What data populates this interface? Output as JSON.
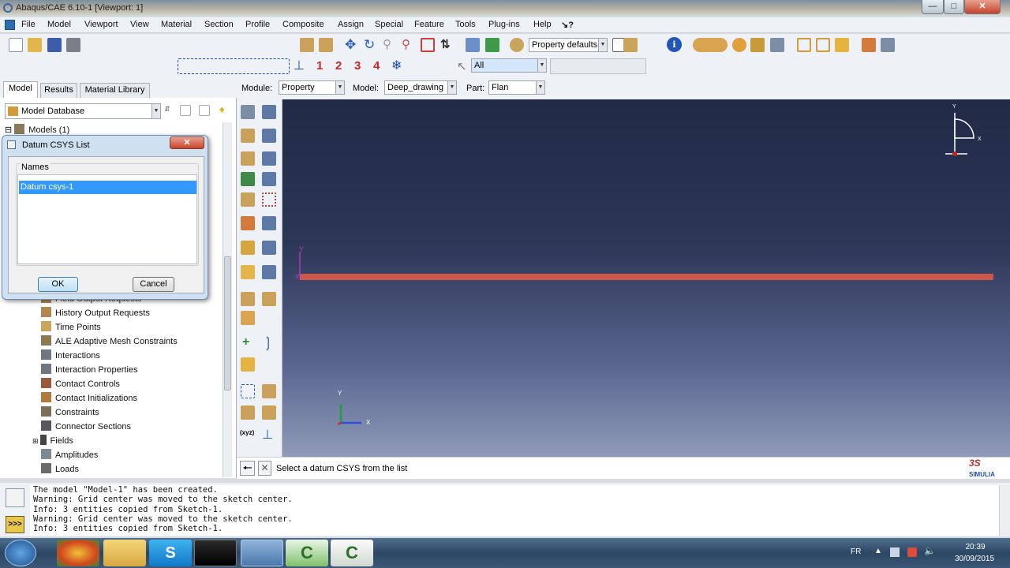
{
  "window": {
    "title": "Abaqus/CAE 6.10-1 [Viewport: 1]"
  },
  "menu": [
    "File",
    "Model",
    "Viewport",
    "View",
    "Material",
    "Section",
    "Profile",
    "Composite",
    "Assign",
    "Special",
    "Feature",
    "Tools",
    "Plug-ins",
    "Help",
    "↘?"
  ],
  "toolbar": {
    "render_style_select": "Property defaults",
    "selection_filter": "All",
    "numbered_buttons": [
      "1",
      "2",
      "3",
      "4"
    ]
  },
  "context_bar": {
    "module_label": "Module:",
    "module_value": "Property",
    "model_label": "Model:",
    "model_value": "Deep_drawing",
    "part_label": "Part:",
    "part_value": "Flan"
  },
  "left_tabs": [
    "Model",
    "Results",
    "Material Library"
  ],
  "model_tree": {
    "database_select": "Model Database",
    "root": "Models (1)",
    "partial_item": "Field Output Requests",
    "items": [
      "History Output Requests",
      "Time Points",
      "ALE Adaptive Mesh Constraints",
      "Interactions",
      "Interaction Properties",
      "Contact Controls",
      "Contact Initializations",
      "Constraints",
      "Connector Sections",
      "Fields",
      "Amplitudes",
      "Loads"
    ]
  },
  "dialog": {
    "title": "Datum CSYS List",
    "group_label": "Names",
    "items": [
      "Datum csys-1"
    ],
    "ok": "OK",
    "cancel": "Cancel"
  },
  "prompt": {
    "text": "Select a datum CSYS from the list"
  },
  "viewport": {
    "triad_top": {
      "y": "Y",
      "x": "X"
    },
    "triad_bottom": {
      "y": "Y",
      "x": "X"
    },
    "part_triad": {
      "y": "Y",
      "x": "X"
    },
    "brand": "SIMULIA",
    "part_color": "#c9574a",
    "triad_red": "#c81e1e",
    "triad_green": "#1f9e3a",
    "triad_blue": "#2f4fd8"
  },
  "messages": [
    "The model \"Model-1\" has been created.",
    "Warning: Grid center was moved to the sketch center.",
    "Info: 3 entities copied from Sketch-1.",
    "Warning: Grid center was moved to the sketch center.",
    "Info: 3 entities copied from Sketch-1."
  ],
  "taskbar": {
    "language": "FR",
    "time": "20:39",
    "date": "30/09/2015"
  }
}
